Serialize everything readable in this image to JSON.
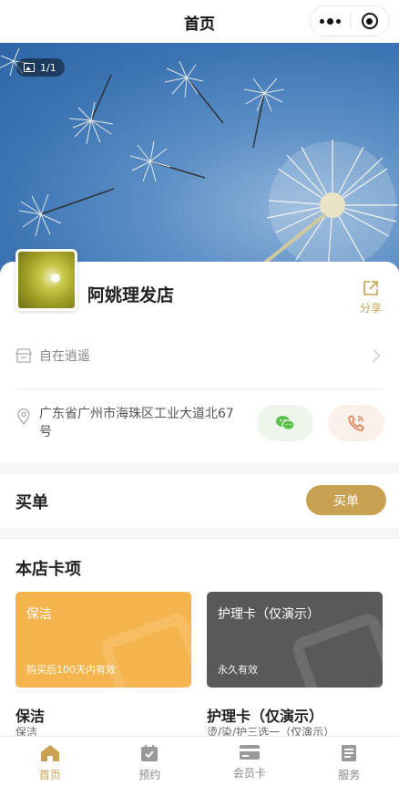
{
  "navbar": {
    "title": "首页"
  },
  "banner": {
    "counter": "1/1"
  },
  "store": {
    "name": "阿姚理发店",
    "share_label": "分享",
    "tag": "自在逍遥",
    "address": "广东省广州市海珠区工业大道北67号"
  },
  "buy": {
    "title": "买单",
    "button": "买单"
  },
  "cards": {
    "title": "本店卡项",
    "items": [
      {
        "name": "保洁",
        "validity": "购买后100天内有效",
        "label": "保洁",
        "subtitle": "保洁",
        "color": "#f5b44d"
      },
      {
        "name": "护理卡（仅演示）",
        "validity": "永久有效",
        "label": "护理卡（仅演示）",
        "subtitle": "烫/染/护三选一（仅演示）",
        "color": "#595959"
      }
    ]
  },
  "tabbar": {
    "active_color": "#c9a152",
    "items": [
      {
        "label": "首页",
        "icon": "home-icon"
      },
      {
        "label": "预约",
        "icon": "calendar-check-icon"
      },
      {
        "label": "会员卡",
        "icon": "card-icon"
      },
      {
        "label": "服务",
        "icon": "list-icon"
      }
    ]
  }
}
